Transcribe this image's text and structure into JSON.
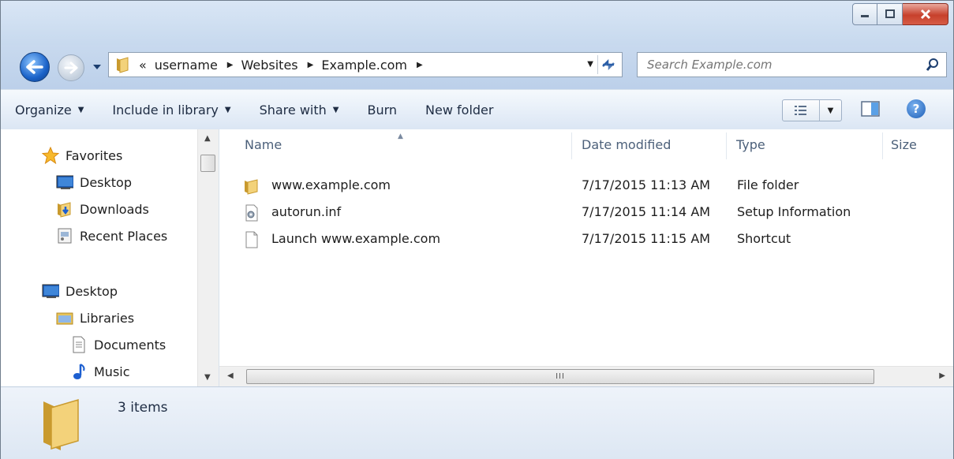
{
  "window": {
    "caption_buttons": [
      {
        "name": "minimize",
        "icon": "minimize-icon"
      },
      {
        "name": "maximize",
        "icon": "maximize-icon"
      },
      {
        "name": "close",
        "icon": "close-icon"
      }
    ]
  },
  "nav": {
    "back_icon": "back-arrow-icon",
    "forward_icon": "forward-arrow-icon",
    "address": {
      "overflow": "«",
      "crumbs": [
        "username",
        "Websites",
        "Example.com"
      ]
    },
    "search": {
      "placeholder": "Search Example.com"
    }
  },
  "toolbar": {
    "organize": "Organize",
    "include_in_library": "Include in library",
    "share_with": "Share with",
    "burn": "Burn",
    "new_folder": "New folder",
    "help": "?"
  },
  "sidebar": {
    "favorites": {
      "label": "Favorites",
      "items": [
        "Desktop",
        "Downloads",
        "Recent Places"
      ]
    },
    "desktop": {
      "label": "Desktop",
      "libraries": "Libraries",
      "library_items": [
        "Documents",
        "Music"
      ]
    }
  },
  "filelist": {
    "columns": [
      "Name",
      "Date modified",
      "Type",
      "Size"
    ],
    "rows": [
      {
        "name": "www.example.com",
        "date": "7/17/2015 11:13 AM",
        "type": "File folder",
        "icon": "folder-icon"
      },
      {
        "name": "autorun.inf",
        "date": "7/17/2015 11:14 AM",
        "type": "Setup Information",
        "icon": "setup-file-icon"
      },
      {
        "name": "Launch www.example.com",
        "date": "7/17/2015 11:15 AM",
        "type": "Shortcut",
        "icon": "shortcut-file-icon"
      }
    ],
    "hscroll_grip": "III"
  },
  "details": {
    "count": "3 items"
  },
  "colors": {
    "chrome_blue": "#c7d9ee",
    "accent_blue": "#1b63c9",
    "folder_yellow": "#e9c15a"
  }
}
